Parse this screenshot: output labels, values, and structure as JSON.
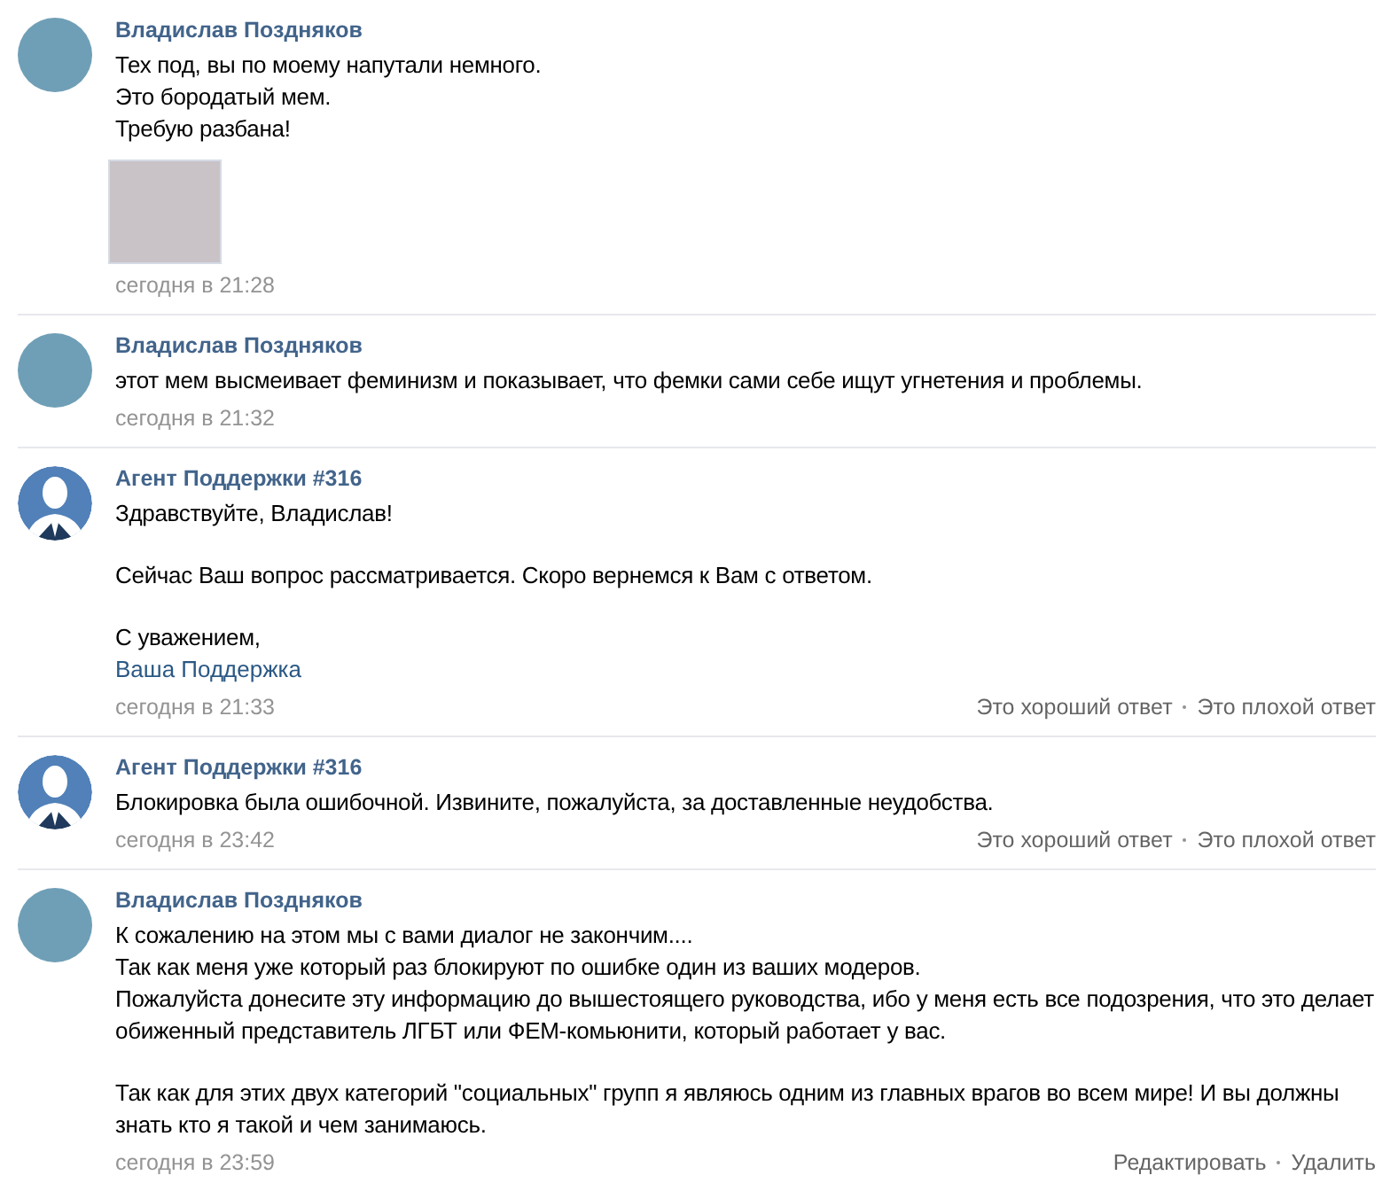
{
  "messages": [
    {
      "author": "Владислав Поздняков",
      "avatar": {
        "kind": "photo"
      },
      "blocks": [
        [
          "Тех под, вы по моему напутали немного.",
          "Это бородатый мем.",
          "Требую разбана!"
        ]
      ],
      "attachment": {
        "kind": "image"
      },
      "time": "сегодня в 21:28"
    },
    {
      "author": "Владислав Поздняков",
      "avatar": {
        "kind": "photo"
      },
      "blocks": [
        [
          "этот мем высмеивает феминизм и показывает, что фемки сами себе ищут угнетения и проблемы."
        ]
      ],
      "time": "сегодня в 21:32"
    },
    {
      "author": "Агент Поддержки #316",
      "avatar": {
        "kind": "agent"
      },
      "blocks": [
        [
          "Здравствуйте, Владислав!"
        ],
        [
          "Сейчас Ваш вопрос рассматривается. Скоро вернемся к Вам с ответом."
        ],
        [
          "С уважением,"
        ]
      ],
      "signature": "Ваша Поддержка",
      "time": "сегодня в 21:33",
      "actions": [
        "Это хороший ответ",
        "Это плохой ответ"
      ]
    },
    {
      "author": "Агент Поддержки #316",
      "avatar": {
        "kind": "agent"
      },
      "blocks": [
        [
          "Блокировка была ошибочной. Извините, пожалуйста, за доставленные неудобства."
        ]
      ],
      "time": "сегодня в 23:42",
      "actions": [
        "Это хороший ответ",
        "Это плохой ответ"
      ]
    },
    {
      "author": "Владислав Поздняков",
      "avatar": {
        "kind": "photo"
      },
      "blocks": [
        [
          "К сожалению на этом мы с вами диалог не закончим....",
          "Так как меня уже который раз блокируют по ошибке один из ваших модеров.",
          "Пожалуйста донесите эту информацию до вышестоящего руководства, ибо у меня есть все подозрения, что это делает обиженный представитель ЛГБТ или ФЕМ-комьюнити, который работает у вас."
        ],
        [
          "Так как для этих двух категорий \"социальных\" групп я являюсь одним из главных врагов во всем мире! И вы должны знать кто я такой и чем занимаюсь."
        ]
      ],
      "time": "сегодня в 23:59",
      "actions": [
        "Редактировать",
        "Удалить"
      ]
    }
  ]
}
